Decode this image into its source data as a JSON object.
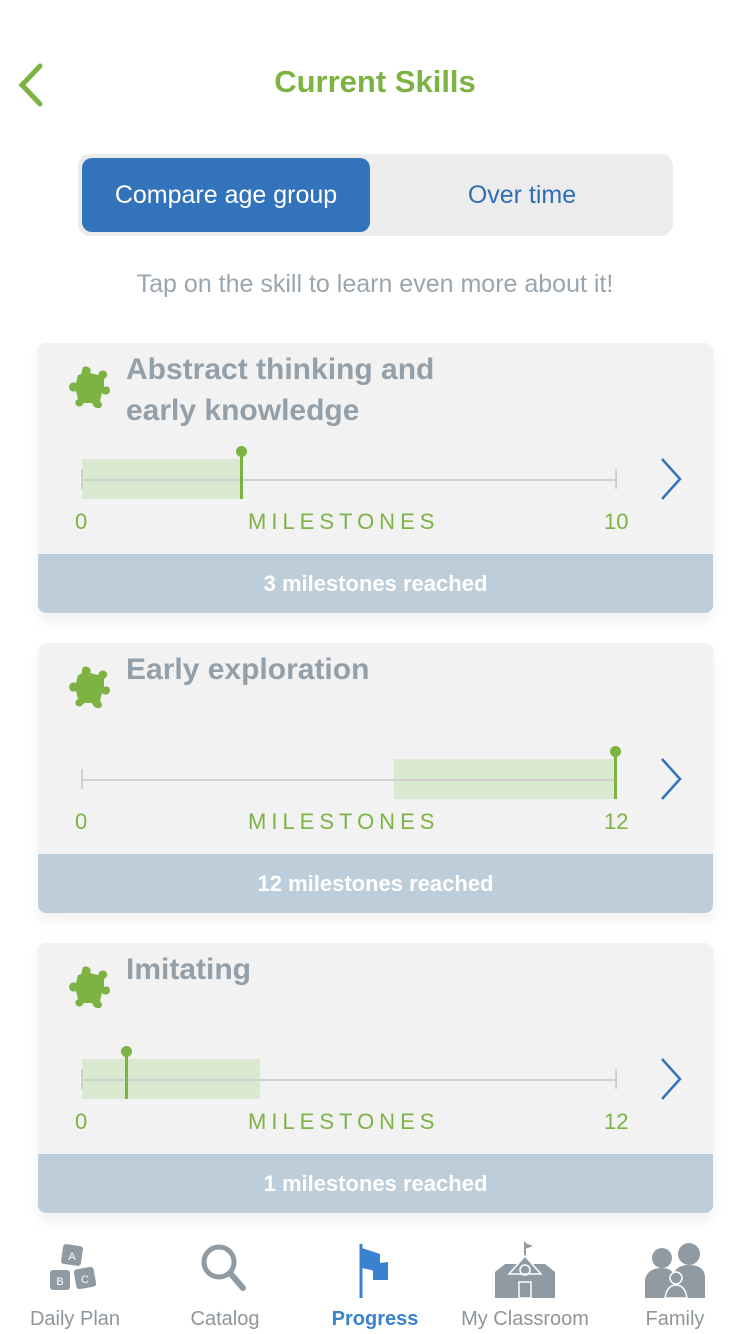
{
  "header": {
    "title": "Current Skills"
  },
  "segmented": {
    "options": [
      "Compare age group",
      "Over time"
    ],
    "selected": "Compare age group"
  },
  "hint": "Tap on the skill to learn even more about it!",
  "colors": {
    "accent_green": "#7cb342",
    "accent_blue": "#3273bb",
    "band": "#d9ead0",
    "footer": "#bdcdd9"
  },
  "skills": [
    {
      "title": "Abstract thinking and early knowledge",
      "min": "0",
      "max": "10",
      "axis_label": "MILESTONES",
      "reached": 3,
      "max_value": 10,
      "age_range": [
        0,
        3
      ],
      "footer": "3 milestones reached"
    },
    {
      "title": "Early exploration",
      "min": "0",
      "max": "12",
      "axis_label": "MILESTONES",
      "reached": 12,
      "max_value": 12,
      "age_range": [
        7,
        12
      ],
      "footer": "12 milestones reached"
    },
    {
      "title": "Imitating",
      "min": "0",
      "max": "12",
      "axis_label": "MILESTONES",
      "reached": 1,
      "max_value": 12,
      "age_range": [
        0,
        4
      ],
      "footer": "1 milestones reached"
    }
  ],
  "tabs": [
    {
      "label": "Daily Plan",
      "icon": "abc-blocks-icon"
    },
    {
      "label": "Catalog",
      "icon": "search-icon"
    },
    {
      "label": "Progress",
      "icon": "flag-icon",
      "active": true
    },
    {
      "label": "My Classroom",
      "icon": "school-icon"
    },
    {
      "label": "Family",
      "icon": "family-icon"
    }
  ]
}
